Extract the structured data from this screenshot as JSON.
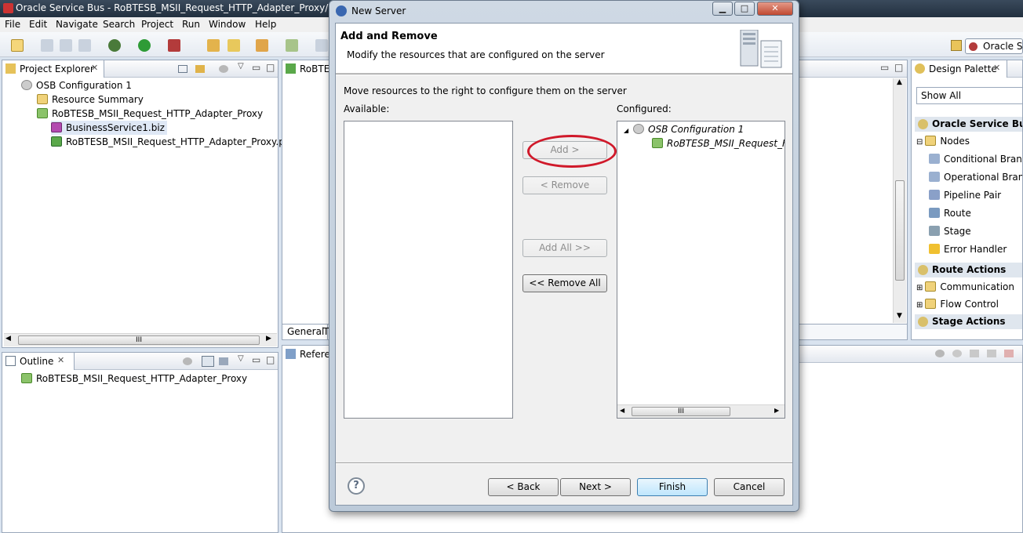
{
  "window": {
    "title": "Oracle Service Bus - RoBTESB_MSII_Request_HTTP_Adapter_Proxy/RoBTESB"
  },
  "menu": [
    "File",
    "Edit",
    "Navigate",
    "Search",
    "Project",
    "Run",
    "Window",
    "Help"
  ],
  "project_explorer": {
    "tab_label": "Project Explorer",
    "items": [
      "OSB Configuration 1",
      "Resource Summary",
      "RoBTESB_MSII_Request_HTTP_Adapter_Proxy",
      "BusinessService1.biz",
      "RoBTESB_MSII_Request_HTTP_Adapter_Proxy.proxy"
    ]
  },
  "outline": {
    "tab_label": "Outline",
    "items": [
      "RoBTESB_MSII_Request_HTTP_Adapter_Proxy"
    ]
  },
  "editor": {
    "tab_label": "RoBTES",
    "bottom_tabs": [
      "General",
      "T"
    ]
  },
  "reference": {
    "tab_label": "Referer"
  },
  "perspective": {
    "label": "Oracle Se"
  },
  "design_palette": {
    "tab_label": "Design Palette",
    "filter": "Show All",
    "section_osb": "Oracle Service Bus P",
    "nodes_label": "Nodes",
    "nodes": [
      "Conditional Branch",
      "Operational Branch",
      "Pipeline Pair",
      "Route",
      "Stage",
      "Error Handler"
    ],
    "section_route_actions": "Route Actions",
    "route_items": [
      "Communication",
      "Flow Control"
    ],
    "section_stage_actions": "Stage Actions"
  },
  "dialog": {
    "title": "New Server",
    "header_title": "Add and Remove",
    "header_desc": "Modify the resources that are configured on the server",
    "instruction": "Move resources to the right to configure them on the server",
    "available_label": "Available:",
    "configured_label": "Configured:",
    "configured_tree": {
      "root": "OSB Configuration 1",
      "child": "RoBTESB_MSII_Request_HTTP"
    },
    "buttons": {
      "add": "Add >",
      "remove": "< Remove",
      "add_all": "Add All >>",
      "remove_all": "<< Remove All",
      "back": "< Back",
      "next": "Next >",
      "finish": "Finish",
      "cancel": "Cancel"
    },
    "scroll_grip": "III",
    "help": "?"
  },
  "colors": {
    "accent": "#3c7fb1",
    "highlight_ring": "#d0192a"
  }
}
